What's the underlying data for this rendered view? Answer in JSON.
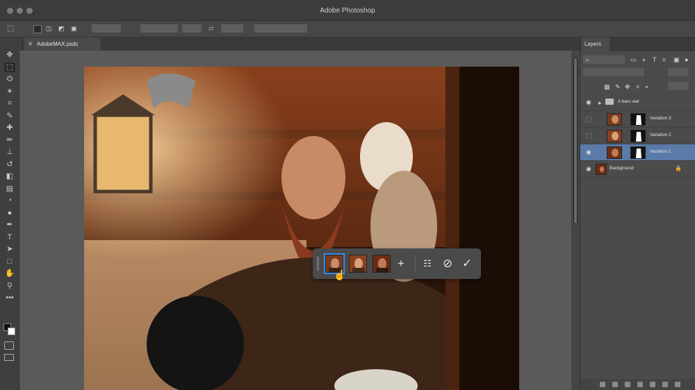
{
  "app": {
    "title": "Adobe Photoshop"
  },
  "document": {
    "tab_name": "AdobeMAX.psdc",
    "close_glyph": "✕"
  },
  "toolbar": {
    "tools": [
      {
        "name": "move-tool",
        "glyph": "✥"
      },
      {
        "name": "marquee-tool",
        "glyph": "⬚"
      },
      {
        "name": "lasso-tool",
        "glyph": "ʘ"
      },
      {
        "name": "magic-wand-tool",
        "glyph": "✶"
      },
      {
        "name": "crop-tool",
        "glyph": "⌗"
      },
      {
        "name": "eyedropper-tool",
        "glyph": "✎"
      },
      {
        "name": "healing-tool",
        "glyph": "✚"
      },
      {
        "name": "brush-tool",
        "glyph": "✏"
      },
      {
        "name": "stamp-tool",
        "glyph": "⊥"
      },
      {
        "name": "history-brush-tool",
        "glyph": "↺"
      },
      {
        "name": "eraser-tool",
        "glyph": "◧"
      },
      {
        "name": "gradient-tool",
        "glyph": "▤"
      },
      {
        "name": "blur-tool",
        "glyph": "◔"
      },
      {
        "name": "dodge-tool",
        "glyph": "●"
      },
      {
        "name": "pen-tool",
        "glyph": "✒"
      },
      {
        "name": "type-tool",
        "glyph": "T"
      },
      {
        "name": "path-select-tool",
        "glyph": "➤"
      },
      {
        "name": "shape-tool",
        "glyph": "□"
      },
      {
        "name": "hand-tool",
        "glyph": "✋"
      },
      {
        "name": "zoom-tool",
        "glyph": "⚲"
      },
      {
        "name": "more-tools",
        "glyph": "•••"
      }
    ]
  },
  "floating_bar": {
    "icons": {
      "add": "+",
      "settings": "☷",
      "cancel": "⊘",
      "confirm": "✓"
    }
  },
  "layers_panel": {
    "tab": "Layers",
    "group": {
      "name": "A barn owl"
    },
    "layers": [
      {
        "name": "Variation 3",
        "selected": false,
        "visible": false
      },
      {
        "name": "Variation 2",
        "selected": false,
        "visible": false
      },
      {
        "name": "Variation 1",
        "selected": true,
        "visible": true
      }
    ],
    "background": {
      "name": "Background"
    },
    "icons": {
      "eye": "◉",
      "folder": "▸",
      "lock": "🔒"
    }
  },
  "colors": {
    "selection_blue": "#3b8cf0",
    "layer_selected": "#5a7aa8"
  }
}
